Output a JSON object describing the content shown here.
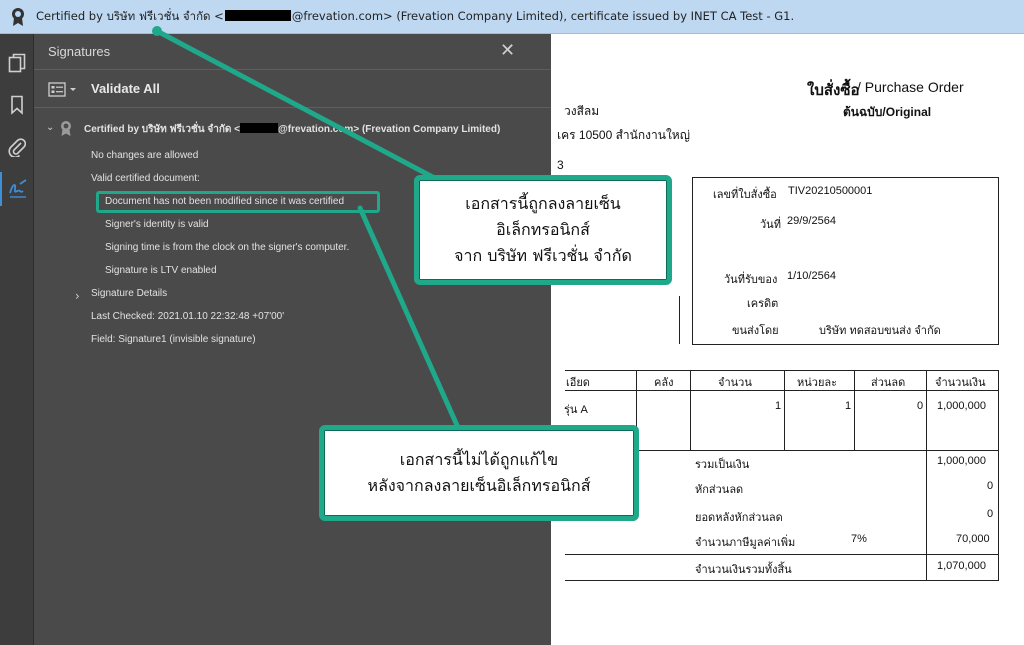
{
  "banner": {
    "prefix": "Certified by บริษัท ฟรีเวชั่น จำกัด <",
    "suffix": "@frevation.com> (Frevation Company Limited), certificate issued by INET CA Test - G1."
  },
  "rail": {
    "icons": [
      "pages-icon",
      "bookmark-icon",
      "attachment-icon",
      "signature-icon"
    ]
  },
  "panel": {
    "title": "Signatures",
    "close": "✕",
    "validate_all": "Validate All",
    "signature": {
      "prefix": "Certified by บริษัท ฟรีเวชั่น จำกัด <",
      "suffix": "@frevation.com> (Frevation Company Limited)"
    },
    "items": [
      "No changes are allowed",
      "Valid certified document:",
      "Document has not been modified since it was certified",
      "Signer's identity is valid",
      "Signing time is from the clock on the signer's computer.",
      "Signature is LTV enabled",
      "Signature Details",
      "Last Checked: 2021.01.10 22:32:48 +07'00'",
      "Field: Signature1 (invisible signature)"
    ]
  },
  "document": {
    "title_th": "ใบสั่งซื้อ",
    "title_en": " / Purchase Order",
    "original": "ต้นฉบับ/Original",
    "addr1": "วงสีลม",
    "addr2": "เคร 10500 สำนักงานใหญ่",
    "addr3": "3",
    "po_label": "เลขที่ใบสั่งซื้อ",
    "po_number": "TIV20210500001",
    "date_label": "วันที่",
    "date_value": "29/9/2564",
    "receive_label": "วันที่รับของ",
    "receive_value": "1/10/2564",
    "credit_label": "เครดิต",
    "ship_label": "ขนส่งโดย",
    "ship_value": "บริษัท ทดสอบขนส่ง จำกัด",
    "headers": [
      "เอียด",
      "คลัง",
      "จำนวน",
      "หน่วยละ",
      "ส่วนลด",
      "จำนวนเงิน"
    ],
    "row": [
      "รุ่น A",
      "",
      "1",
      "1",
      "0",
      "1,000,000"
    ],
    "totals": [
      {
        "label": "รวมเป็นเงิน",
        "value": "1,000,000"
      },
      {
        "label": "หักส่วนลด",
        "value": "0"
      },
      {
        "label": "ยอดหลังหักส่วนลด",
        "value": "0"
      },
      {
        "label": "จำนวนภาษีมูลค่าเพิ่ม",
        "rate": "7%",
        "value": "70,000"
      },
      {
        "label": "จำนวนเงินรวมทั้งสิ้น",
        "value": "1,070,000"
      }
    ]
  },
  "callouts": {
    "top": [
      "เอกสารนี้ถูกลงลายเซ็น",
      "อิเล็กทรอนิกส์",
      "จาก บริษัท ฟรีเวชั่น จำกัด"
    ],
    "bottom": [
      "เอกสารนี้ไม่ได้ถูกแก้ไข",
      "หลังจากลงลายเซ็นอิเล็กทรอนิกส์"
    ]
  },
  "colors": {
    "accent": "#1fa88a",
    "banner": "#bed8f2",
    "panel": "#4a4a4a",
    "rail": "#3d3d3d"
  }
}
